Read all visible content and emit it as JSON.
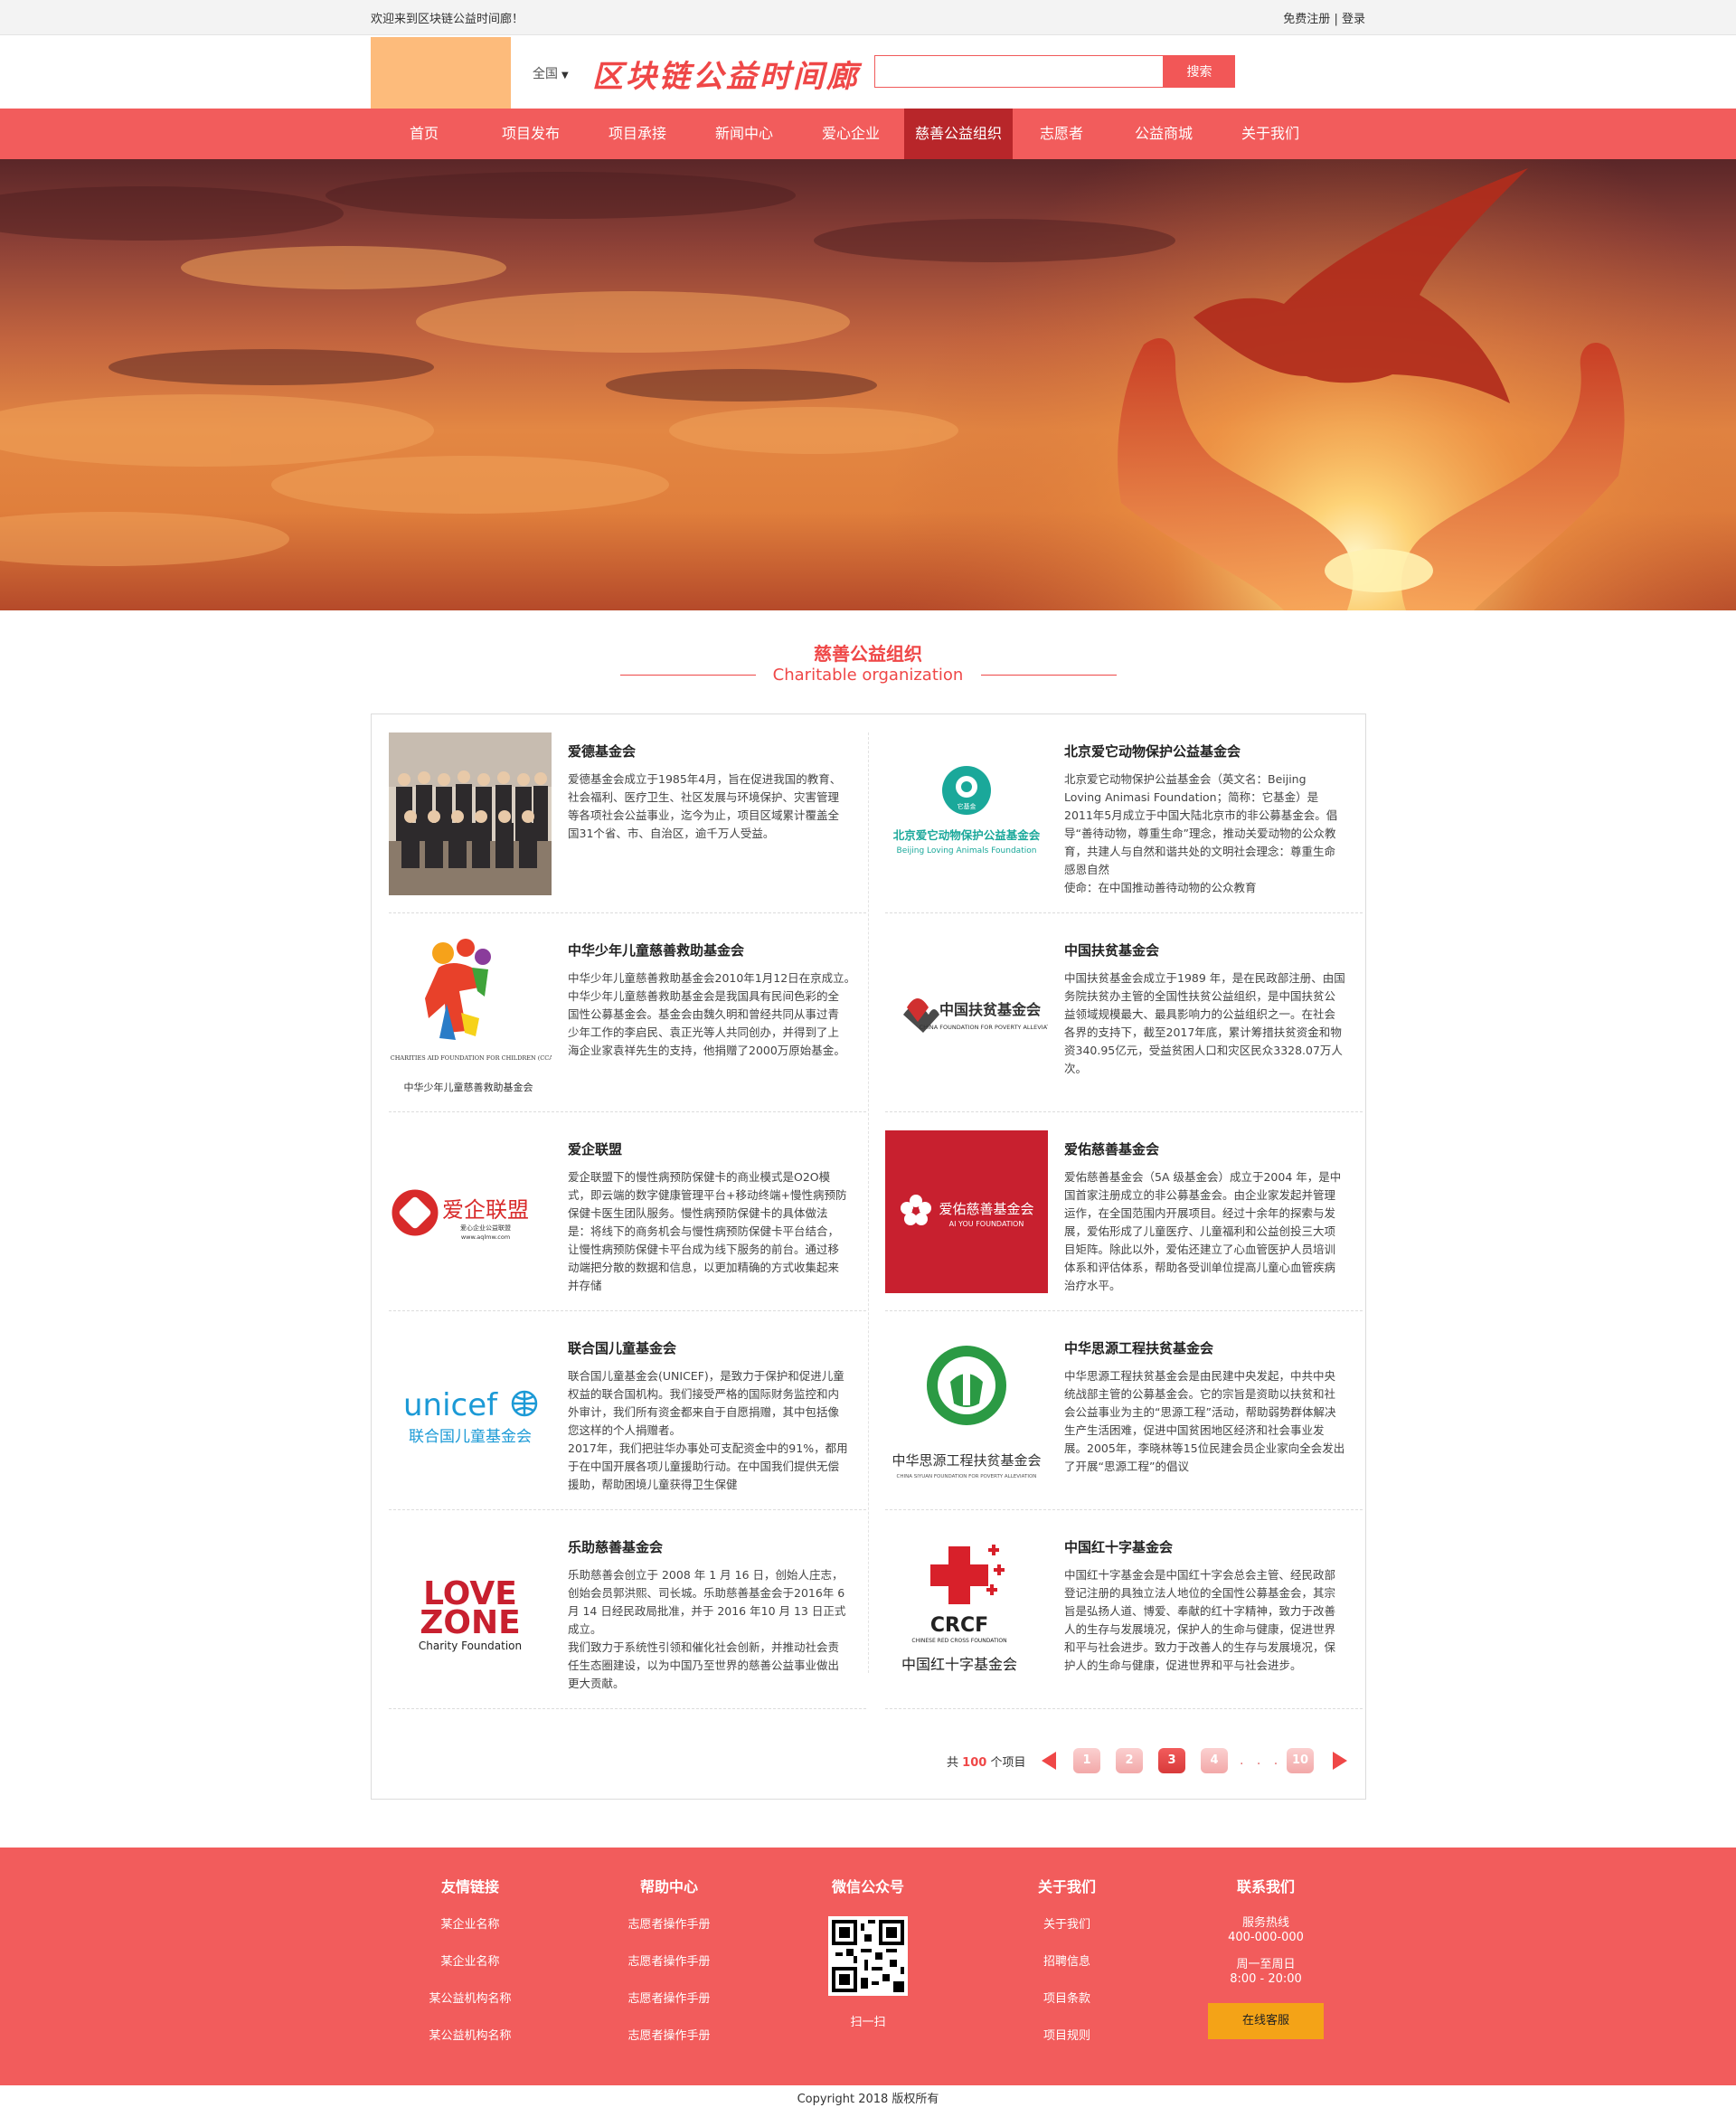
{
  "topbar": {
    "welcome": "欢迎来到区块链公益时间廊！",
    "register": "免费注册",
    "separator": "|",
    "login": "登录"
  },
  "header": {
    "region": "全国",
    "title": "区块链公益时间廊",
    "search_placeholder": "",
    "search_button": "搜索"
  },
  "nav": {
    "items": [
      "首页",
      "项目发布",
      "项目承接",
      "新闻中心",
      "爱心企业",
      "慈善公益组织",
      "志愿者",
      "公益商城",
      "关于我们"
    ],
    "active_index": 5
  },
  "section": {
    "title": "慈善公益组织",
    "subtitle": "Charitable organization"
  },
  "orgs": [
    {
      "name": "爱德基金会",
      "desc": "爱德基金会成立于1985年4月，旨在促进我国的教育、社会福利、医疗卫生、社区发展与环境保护、灾害管理等各项社会公益事业，迄今为止，项目区域累计覆盖全国31个省、市、自治区，逾千万人受益。",
      "logo": "group-photo"
    },
    {
      "name": "北京爱它动物保护公益基金会",
      "desc": "北京爱它动物保护公益基金会（英文名：Beijing Loving Animasi Foundation；简称：它基金）是2011年5月成立于中国大陆北京市的非公募基金会。倡导“善待动物，尊重生命”理念，推动关爱动物的公众教育，共建人与自然和谐共处的文明社会理念：尊重生命 感恩自然\n使命：在中国推动善待动物的公众教育",
      "logo": "beijing-loving-animals-logo",
      "logo_text_cn": "北京爱它动物保护公益基金会",
      "logo_text_en": "Beijing Loving Animals Foundation",
      "logo_badge": "它基金"
    },
    {
      "name": "中华少年儿童慈善救助基金会",
      "desc": "中华少年儿童慈善救助基金会2010年1月12日在京成立。　中华少年儿童慈善救助基金会是我国具有民间色彩的全国性公募基金会。基金会由魏久明和曾经共同从事过青少年工作的李启民、袁正光等人共同创办，并得到了上海企业家袁祥先生的支持，他捐赠了2000万原始基金。",
      "logo": "ccafc-logo",
      "logo_text_en": "CHINA CHARITIES AID FOUNDATION FOR CHILDREN (CCAFC)",
      "logo_text_cn": "中华少年儿童慈善救助基金会"
    },
    {
      "name": "中国扶贫基金会",
      "desc": "中国扶贫基金会成立于1989 年，是在民政部注册、由国务院扶贫办主管的全国性扶贫公益组织，是中国扶贫公益领域规模最大、最具影响力的公益组织之一。在社会各界的支持下，截至2017年底，累计筹措扶贫资金和物资340.95亿元，受益贫困人口和灾区民众3328.07万人次。",
      "logo": "cfpa-logo",
      "logo_text_cn": "中国扶贫基金会",
      "logo_text_en": "CHINA FOUNDATION FOR POVERTY ALLEVIATION"
    },
    {
      "name": "爱企联盟",
      "desc": "爱企联盟下的慢性病预防保健卡的商业模式是O2O模式，即云端的数字健康管理平台+移动终端+慢性病预防保健卡医生团队服务。慢性病预防保健卡的具体做法是：将线下的商务机会与慢性病预防保健卡平台结合，让慢性病预防保健卡平台成为线下服务的前台。通过移动端把分散的数据和信息，以更加精确的方式收集起来并存储",
      "logo": "aiqi-logo",
      "logo_text_cn": "爱企联盟",
      "logo_text_sub": "爱心企业公益联盟",
      "logo_text_url": "www.aqlmw.com"
    },
    {
      "name": "爱佑慈善基金会",
      "desc": "爱佑慈善基金会（5A 级基金会）成立于2004 年，是中国首家注册成立的非公募基金会。由企业家发起并管理运作，在全国范围内开展项目。经过十余年的探索与发展，爱佑形成了儿童医疗、儿童福利和公益创投三大项目矩阵。除此以外，爱佑还建立了心血管医护人员培训体系和评估体系，帮助各受训单位提高儿童心血管疾病治疗水平。",
      "logo": "aiyou-logo",
      "logo_text_cn": "爱佑慈善基金会",
      "logo_text_en": "AI YOU FOUNDATION"
    },
    {
      "name": "联合国儿童基金会",
      "desc": "联合国儿童基金会(UNICEF)，是致力于保护和促进儿童权益的联合国机构。我们接受严格的国际财务监控和内外审计，我们所有资金都来自于自愿捐赠，其中包括像您这样的个人捐赠者。\n2017年，我们把驻华办事处可支配资金中的91%，都用于在中国开展各项儿童援助行动。在中国我们提供无偿援助，帮助困境儿童获得卫生保健",
      "logo": "unicef-logo",
      "logo_text_en": "unicef",
      "logo_text_cn": "联合国儿童基金会"
    },
    {
      "name": "中华思源工程扶贫基金会",
      "desc": "中华思源工程扶贫基金会是由民建中央发起，中共中央统战部主管的公募基金会。它的宗旨是资助以扶贫和社会公益事业为主的“思源工程”活动，帮助弱势群体解决生产生活困难，促进中国贫困地区经济和社会事业发展。2005年，李晓林等15位民建会员企业家向全会发出了开展“思源工程”的倡议",
      "logo": "siyuan-logo",
      "logo_text_cn": "中华思源工程扶贫基金会",
      "logo_text_en": "CHINA SIYUAN FOUNDATION FOR POVERTY ALLEVIATION"
    },
    {
      "name": "乐助慈善基金会",
      "desc": "乐助慈善会创立于 2008 年 1 月 16 日，创始人庄志，创始会员郭洪熙、司长城。乐助慈善基金会于2016年 6 月 14 日经民政局批准，并于 2016 年10 月 13 日正式成立。\n我们致力于系统性引领和催化社会创新，并推动社会责任生态圈建设，以为中国乃至世界的慈善公益事业做出更大贡献。",
      "logo": "lovezone-logo",
      "logo_text_top": "LOVE",
      "logo_text_mid": "ZONE",
      "logo_text_en": "Charity Foundation"
    },
    {
      "name": "中国红十字基金会",
      "desc": "中国红十字基金会是中国红十字会总会主管、经民政部登记注册的具独立法人地位的全国性公募基金会，其宗旨是弘扬人道、博爱、奉献的红十字精神，致力于改善人的生存与发展境况，保护人的生命与健康，促进世界和平与社会进步。致力于改善人的生存与发展境况，保护人的生命与健康，促进世界和平与社会进步。",
      "logo": "crcf-logo",
      "logo_text_abbr": "CRCF",
      "logo_text_en": "CHINESE RED CROSS FOUNDATION",
      "logo_text_cn": "中国红十字基金会"
    }
  ],
  "pagination": {
    "total_prefix": "共",
    "total": "100",
    "total_suffix": "个项目",
    "pages": [
      "1",
      "2",
      "3",
      "4"
    ],
    "last_page": "10",
    "active": "3",
    "ellipsis": ". . ."
  },
  "footer": {
    "links": {
      "title": "友情链接",
      "items": [
        "某企业名称",
        "某企业名称",
        "某公益机构名称",
        "某公益机构名称"
      ]
    },
    "help": {
      "title": "帮助中心",
      "items": [
        "志愿者操作手册",
        "志愿者操作手册",
        "志愿者操作手册",
        "志愿者操作手册"
      ]
    },
    "wechat": {
      "title": "微信公众号",
      "caption": "扫一扫"
    },
    "about": {
      "title": "关于我们",
      "items": [
        "关于我们",
        "招聘信息",
        "项目条款",
        "项目规则"
      ]
    },
    "contact": {
      "title": "联系我们",
      "hotline_label": "服务热线",
      "hotline": "400-000-000",
      "days": "周一至周日",
      "hours": "8:00 - 20:00",
      "online_button": "在线客服"
    },
    "copyright": "Copyright 2018 版权所有"
  },
  "colors": {
    "brand_red": "#f25c5c",
    "nav_active": "#b8262a",
    "accent_orange": "#f4a317",
    "logo_placeholder": "#fdbb7b"
  }
}
